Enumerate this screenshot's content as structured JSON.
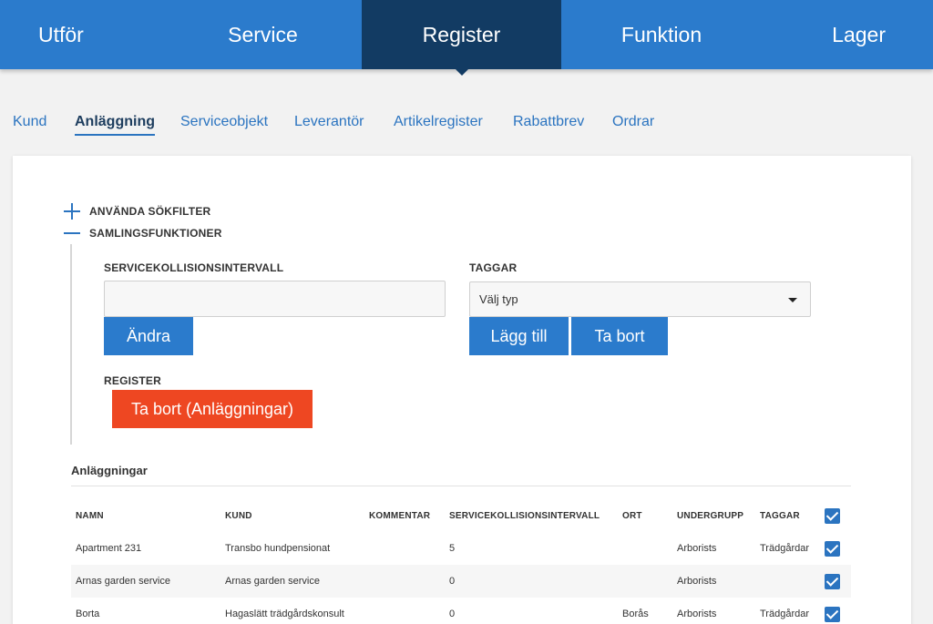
{
  "topnav": {
    "tabs": [
      "Utför",
      "Service",
      "Register",
      "Funktion",
      "Lager"
    ],
    "active": "Register"
  },
  "subnav": {
    "items": [
      "Kund",
      "Anläggning",
      "Serviceobjekt",
      "Leverantör",
      "Artikelregister",
      "Rabattbrev",
      "Ordrar"
    ],
    "active": "Anläggning"
  },
  "filters": {
    "search_filter": "ANVÄNDA SÖKFILTER",
    "collection": "SAMLINGSFUNKTIONER"
  },
  "form": {
    "service_interval_label": "SERVICEKOLLISIONSINTERVALL",
    "service_interval_value": "",
    "change_button": "Ändra",
    "tags_label": "TAGGAR",
    "tags_select": "Välj typ",
    "add_button": "Lägg till",
    "remove_button": "Ta bort",
    "register_label": "REGISTER",
    "delete_register_button": "Ta bort (Anläggningar)"
  },
  "table": {
    "title": "Anläggningar",
    "headers": {
      "namn": "NAMN",
      "kund": "KUND",
      "kommentar": "KOMMENTAR",
      "sci": "SERVICEKOLLISIONSINTERVALL",
      "ort": "ORT",
      "undergrupp": "UNDERGRUPP",
      "taggar": "TAGGAR"
    },
    "rows": [
      {
        "namn": "Apartment 231",
        "kund": "Transbo hundpensionat",
        "kommentar": "",
        "sci": "5",
        "ort": "",
        "undergrupp": "Arborists",
        "taggar": "Trädgårdar"
      },
      {
        "namn": "Arnas garden service",
        "kund": "Arnas garden service",
        "kommentar": "",
        "sci": "0",
        "ort": "",
        "undergrupp": "Arborists",
        "taggar": ""
      },
      {
        "namn": "Borta",
        "kund": "Hagaslätt trädgårdskonsult",
        "kommentar": "",
        "sci": "0",
        "ort": "Borås",
        "undergrupp": "Arborists",
        "taggar": "Trädgårdar"
      }
    ]
  },
  "colors": {
    "primary": "#2b7bcc",
    "active_tab": "#123b63",
    "danger": "#ee4722"
  }
}
